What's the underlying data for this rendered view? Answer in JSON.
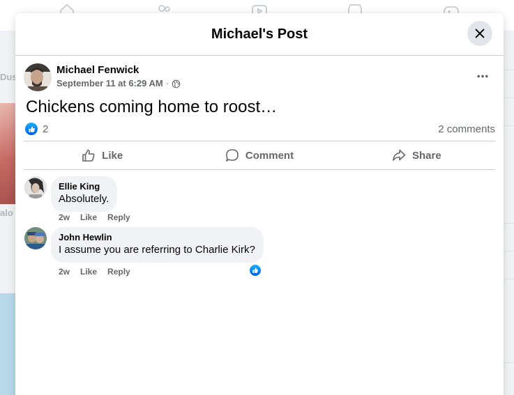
{
  "modal": {
    "title": "Michael's Post"
  },
  "background": {
    "left_labels": [
      "Dus",
      "alo"
    ]
  },
  "post": {
    "author": "Michael Fenwick",
    "timestamp": "September 11 at 6:29 AM",
    "separator": "·",
    "audience_icon": "globe-icon",
    "text": "Chickens coming home to roost…",
    "reaction_count": "2",
    "comments_count": "2 comments"
  },
  "actions": {
    "like": "Like",
    "comment": "Comment",
    "share": "Share"
  },
  "comments": [
    {
      "author": "Ellie King",
      "text": "Absolutely.",
      "age": "2w",
      "like": "Like",
      "reply": "Reply"
    },
    {
      "author": "John Hewlin",
      "text": "I assume you are referring to Charlie Kirk?",
      "age": "2w",
      "like": "Like",
      "reply": "Reply",
      "reaction_icon": "like-icon"
    }
  ],
  "colors": {
    "accent": "#0866ff",
    "secondary_text": "#65676b",
    "bubble": "#f0f2f5"
  }
}
